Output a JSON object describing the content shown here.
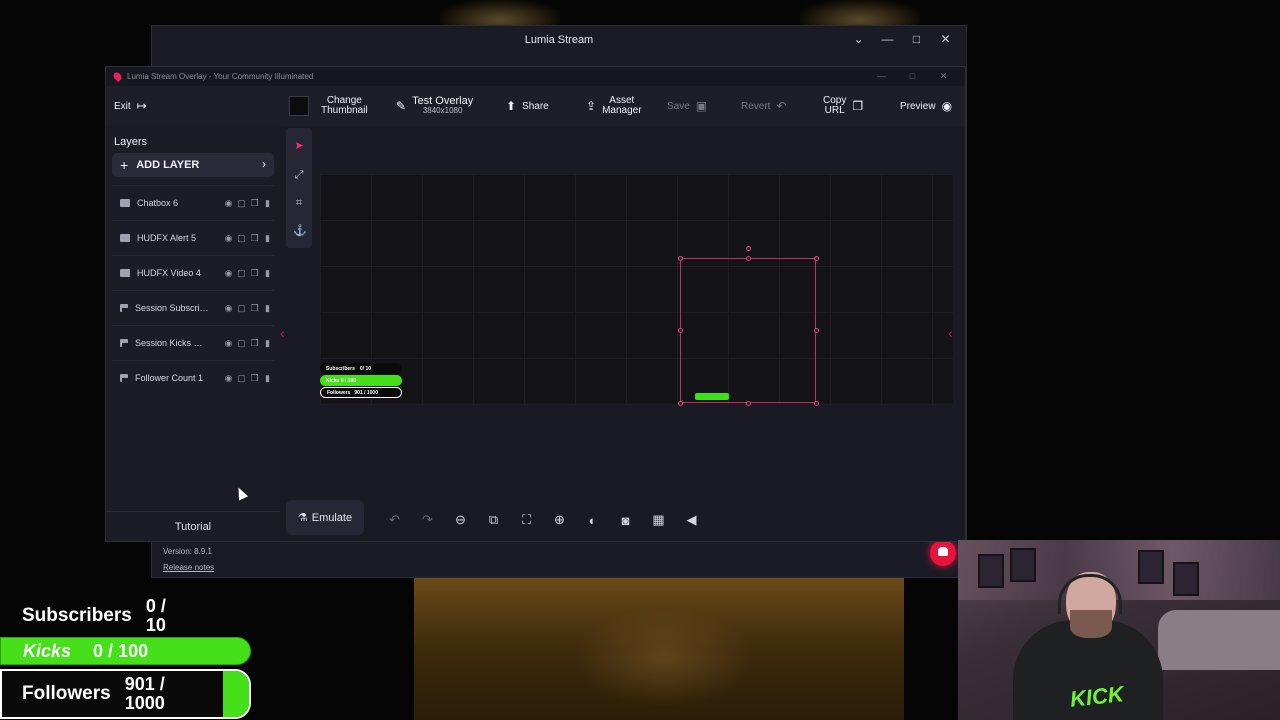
{
  "outer_window": {
    "title": "Lumia Stream",
    "controls": [
      "⌄",
      "—",
      "□",
      "✕"
    ],
    "version": "Version: 8.9.1",
    "release_notes": "Release notes"
  },
  "editor_window": {
    "title": "Lumia Stream Overlay - Your Community Illuminated",
    "controls": [
      "—",
      "□",
      "✕"
    ]
  },
  "toolbar": {
    "exit": "Exit",
    "change_thumbnail_1": "Change",
    "change_thumbnail_2": "Thumbnail",
    "test_overlay": "Test Overlay",
    "test_overlay_res": "3840x1080",
    "share": "Share",
    "asset_manager_1": "Asset",
    "asset_manager_2": "Manager",
    "save": "Save",
    "revert": "Revert",
    "copy_url_1": "Copy",
    "copy_url_2": "URL",
    "preview": "Preview"
  },
  "sidebar": {
    "title": "Layers",
    "add_layer": "ADD LAYER",
    "layers": [
      {
        "name": "Chatbox 6",
        "icon": "chat-icon"
      },
      {
        "name": "HUDFX Alert 5",
        "icon": "chat-icon"
      },
      {
        "name": "HUDFX Video 4",
        "icon": "video-icon"
      },
      {
        "name": "Session Subscrib...",
        "icon": "flag-icon"
      },
      {
        "name": "Session Kicks Co...",
        "icon": "flag-icon"
      },
      {
        "name": "Follower Count 1",
        "icon": "flag-icon"
      }
    ],
    "tutorial": "Tutorial"
  },
  "bottom_bar": {
    "emulate": "Emulate"
  },
  "mini_widget": {
    "subs": "Subscribers",
    "subs_val": "0/ 10",
    "kicks": "Kicks   0 / 100",
    "followers": "Followers",
    "followers_val": "901 / 1000"
  },
  "stream_overlay": {
    "subscribers_label": "Subscribers",
    "subscribers_value_1": "0 /",
    "subscribers_value_2": "10",
    "kicks_label": "Kicks",
    "kicks_value": "0 / 100",
    "followers_label": "Followers",
    "followers_value_1": "901 /",
    "followers_value_2": "1000",
    "followers_progress": 0.901
  },
  "webcam": {
    "shirt_text": "KICK"
  },
  "colors": {
    "accent": "#e2245a",
    "kick_green": "#45e01a",
    "editor_bg": "#1a1a24"
  }
}
